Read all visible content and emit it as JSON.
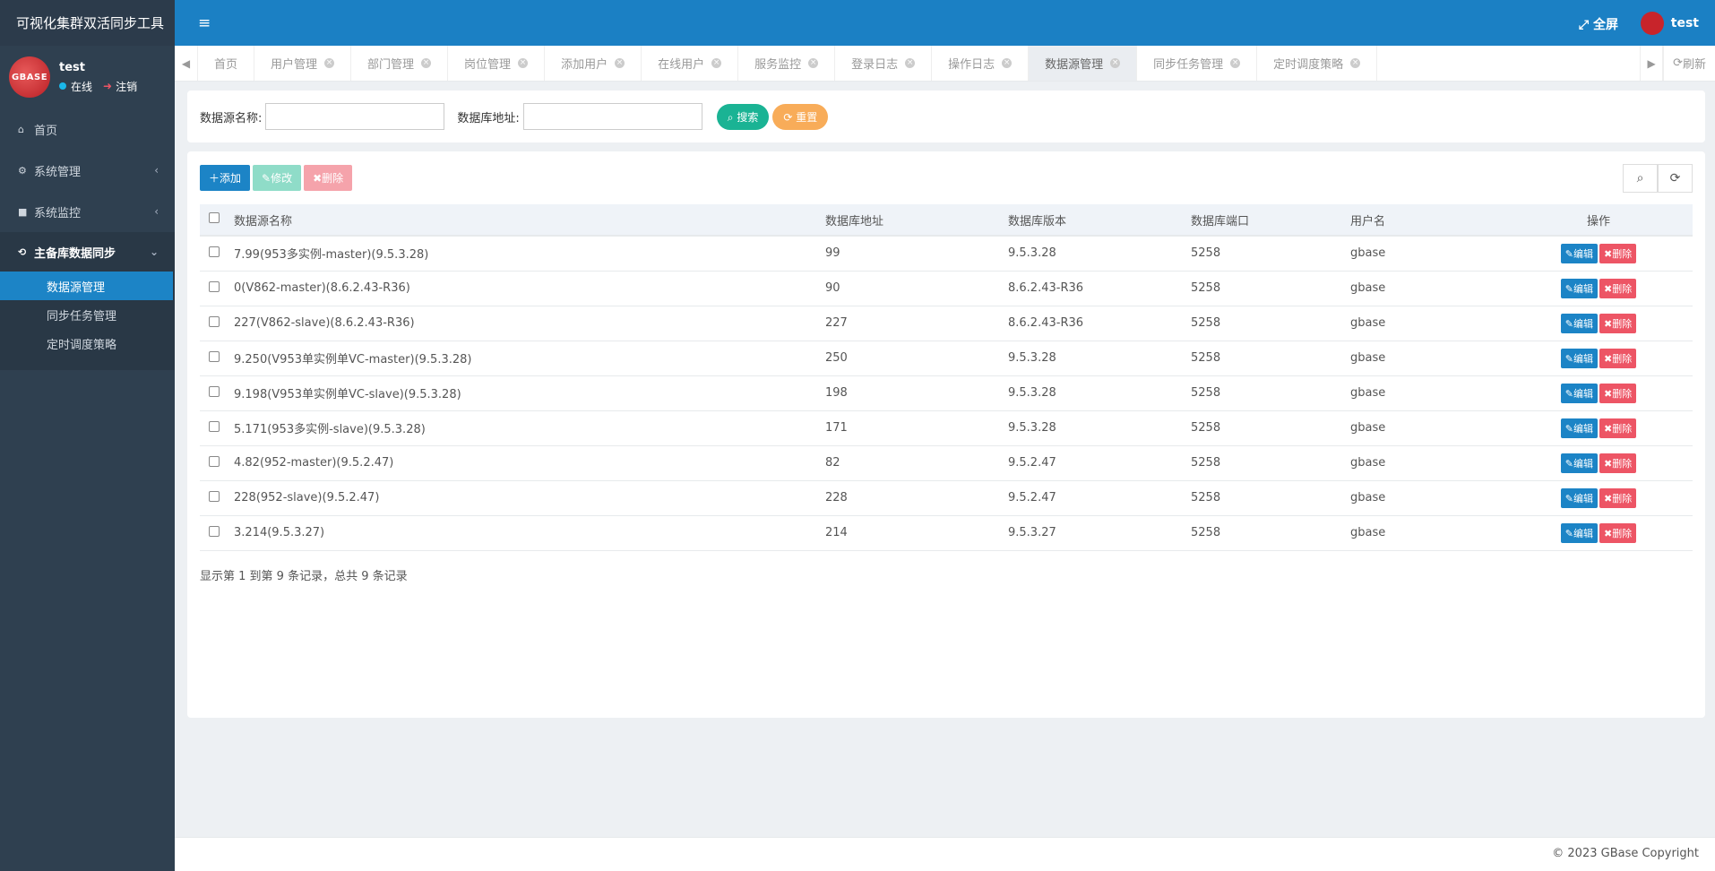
{
  "app": {
    "title": "可视化集群双活同步工具"
  },
  "profile": {
    "avatar_text": "GBASE",
    "name": "test",
    "status": "在线",
    "logout": "注销"
  },
  "nav": {
    "home": "首页",
    "system_mgmt": "系统管理",
    "system_monitor": "系统监控",
    "sync_group": "主备库数据同步",
    "sub_items": [
      "数据源管理",
      "同步任务管理",
      "定时调度策略"
    ]
  },
  "header": {
    "menu_icon": "≡",
    "fullscreen": "全屏",
    "user": "test"
  },
  "tabs": [
    "首页",
    "用户管理",
    "部门管理",
    "岗位管理",
    "添加用户",
    "在线用户",
    "服务监控",
    "登录日志",
    "操作日志",
    "数据源管理",
    "同步任务管理",
    "定时调度策略"
  ],
  "tab_refresh": "刷新",
  "search": {
    "name_label": "数据源名称:",
    "addr_label": "数据库地址:",
    "search_btn": "搜索",
    "reset_btn": "重置"
  },
  "toolbar": {
    "add": "添加",
    "edit": "修改",
    "delete": "删除"
  },
  "table": {
    "headers": [
      "数据源名称",
      "数据库地址",
      "数据库版本",
      "数据库端口",
      "用户名",
      "操作"
    ],
    "rows": [
      {
        "name": "7.99(953多实例-master)(9.5.3.28)",
        "addr": "99",
        "version": "9.5.3.28",
        "port": "5258",
        "user": "gbase"
      },
      {
        "name": "0(V862-master)(8.6.2.43-R36)",
        "addr": "90",
        "version": "8.6.2.43-R36",
        "port": "5258",
        "user": "gbase"
      },
      {
        "name": "227(V862-slave)(8.6.2.43-R36)",
        "addr": "227",
        "version": "8.6.2.43-R36",
        "port": "5258",
        "user": "gbase"
      },
      {
        "name": "9.250(V953单实例单VC-master)(9.5.3.28)",
        "addr": "250",
        "version": "9.5.3.28",
        "port": "5258",
        "user": "gbase"
      },
      {
        "name": "9.198(V953单实例单VC-slave)(9.5.3.28)",
        "addr": "198",
        "version": "9.5.3.28",
        "port": "5258",
        "user": "gbase"
      },
      {
        "name": "5.171(953多实例-slave)(9.5.3.28)",
        "addr": "171",
        "version": "9.5.3.28",
        "port": "5258",
        "user": "gbase"
      },
      {
        "name": "4.82(952-master)(9.5.2.47)",
        "addr": "82",
        "version": "9.5.2.47",
        "port": "5258",
        "user": "gbase"
      },
      {
        "name": "228(952-slave)(9.5.2.47)",
        "addr": "228",
        "version": "9.5.2.47",
        "port": "5258",
        "user": "gbase"
      },
      {
        "name": "3.214(9.5.3.27)",
        "addr": "214",
        "version": "9.5.3.27",
        "port": "5258",
        "user": "gbase"
      }
    ],
    "row_edit": "编辑",
    "row_delete": "删除"
  },
  "record_info": "显示第 1 到第 9 条记录，总共 9 条记录",
  "footer": "© 2023 GBase Copyright",
  "colors": {
    "primary": "#1c84c6",
    "success": "#1ab394",
    "warning": "#f8ac59",
    "danger": "#ed5565",
    "sidebar": "#2f4050"
  }
}
